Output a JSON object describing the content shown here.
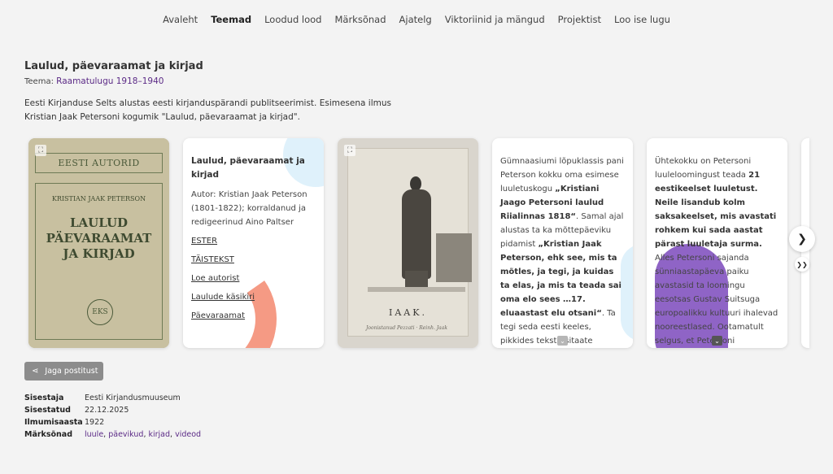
{
  "nav": {
    "items": [
      "Avaleht",
      "Teemad",
      "Loodud lood",
      "Märksõnad",
      "Ajatelg",
      "Viktoriinid ja mängud",
      "Projektist",
      "Loo ise lugu"
    ],
    "active": "Teemad"
  },
  "post": {
    "title": "Laulud, päevaraamat ja kirjad",
    "theme_label": "Teema:",
    "theme_value": "Raamatulugu 1918–1940",
    "intro": "Eesti Kirjanduse Selts alustas eesti kirjanduspärandi publitseerimist. Esimesena ilmus Kristian Jaak Petersoni kogumik \"Laulud, päevaraamat ja kirjad\"."
  },
  "cover": {
    "band": "EESTI AUTORID",
    "author": "KRISTIAN JAAK PETERSON",
    "title_line1": "LAULUD",
    "title_line2": "PÄEVARAAMAT",
    "title_line3": "JA KIRJAD",
    "seal": "EKS"
  },
  "info_card": {
    "title": "Laulud, päevaraamat ja kirjad",
    "meta": "Autor: Kristian Jaak Peterson (1801-1822); korraldanud ja redigeerinud Aino Paltser",
    "links": [
      "ESTER",
      "TÄISTEKST",
      "Loe autorist",
      "Laulude käsikiri",
      "Päevaraamat"
    ]
  },
  "engraving": {
    "caption": "IAAK.",
    "signature": "Joonistanud Pezzati · Reinh. Jaak"
  },
  "text_card_1": {
    "p1": "Gümnaasiumi lõpuklassis pani Peterson kokku oma esimese luuletuskogu ",
    "b1": "„Kristiani Jaago Petersoni laulud Riialinnas 1818“",
    "p2": ". Samal ajal alustas ta ka mõttepäeviku pidamist ",
    "b2": "„Kristian Jaak Peterson, ehk see, mis ta mõtles, ja tegi, ja kuidas ta elas, ja mis ta teada sai oma elo sees …17. eluaastast elu otsani“",
    "p3": ". Ta tegi seda eesti keeles, pikkides teksti tsitaate kreeka, ladina, prantsuse, saksa, inglise, vene"
  },
  "text_card_2": {
    "p1": "Ühtekokku on Petersoni luuleloomingust teada ",
    "b1": "21 eestikeelset luuletust. Neile lisandub kolm saksakeelset, mis avastati rohkem kui sada aastat pärast luuletaja surma.",
    "p2": " Alles Petersoni sajanda sünniaastapäeva paiku avastasid ta loomingu eesotsas Gustav Suitsuga europoalikku kultuuri ihalevad nooreestlased. Ootamatult selgus, et Petersoni enneolematutes"
  },
  "share": {
    "label": "Jaga postitust"
  },
  "details": {
    "rows": [
      {
        "label": "Sisestaja",
        "value": "Eesti Kirjandusmuuseum"
      },
      {
        "label": "Sisestatud",
        "value": "22.12.2025"
      },
      {
        "label": "Ilmumisaasta",
        "value": "1922"
      }
    ],
    "tags_label": "Märksõnad",
    "tags": [
      "luule",
      "päevikud",
      "kirjad",
      "videod"
    ]
  },
  "colors": {
    "accent_purple": "#5b2a86",
    "blob_orange": "#f59a84",
    "blob_purple": "#8f64c6",
    "blob_blue": "#dff1fb"
  }
}
